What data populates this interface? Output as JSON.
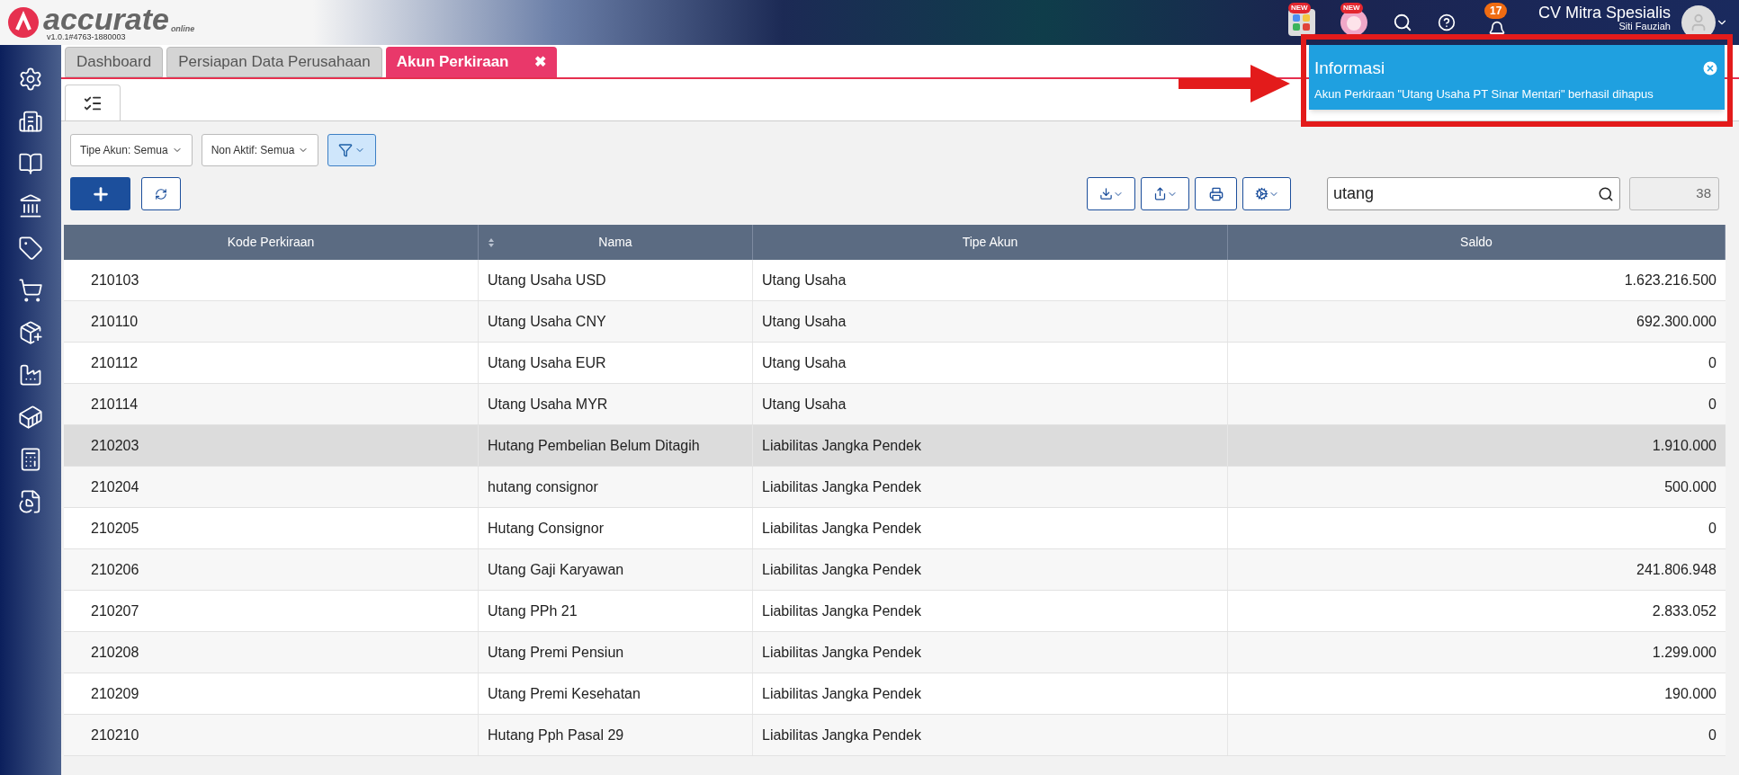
{
  "header": {
    "logo": "accurate",
    "logo_sub": "online",
    "version": "v1.0.1#4763-1880003",
    "new_badges": [
      "NEW",
      "NEW"
    ],
    "notification_count": "17",
    "company": "CV Mitra Spesialis",
    "user": "Siti Fauziah"
  },
  "tabs": [
    {
      "label": "Dashboard",
      "selected": false,
      "closable": false
    },
    {
      "label": "Persiapan Data Perusahaan",
      "selected": false,
      "closable": false
    },
    {
      "label": "Akun Perkiraan",
      "selected": true,
      "closable": true,
      "close": "✖"
    }
  ],
  "filters": [
    {
      "label": "Tipe Akun: Semua"
    },
    {
      "label": "Non Aktif: Semua"
    }
  ],
  "search": {
    "value": "utang",
    "count": "38"
  },
  "table": {
    "columns": [
      "Kode Perkiraan",
      "Nama",
      "Tipe Akun",
      "Saldo"
    ],
    "rows": [
      {
        "code": "210103",
        "name": "Utang Usaha USD",
        "type": "Utang Usaha",
        "balance": "1.623.216.500",
        "highlighted": false
      },
      {
        "code": "210110",
        "name": "Utang Usaha CNY",
        "type": "Utang Usaha",
        "balance": "692.300.000",
        "highlighted": false
      },
      {
        "code": "210112",
        "name": "Utang Usaha EUR",
        "type": "Utang Usaha",
        "balance": "0",
        "highlighted": false
      },
      {
        "code": "210114",
        "name": "Utang Usaha MYR",
        "type": "Utang Usaha",
        "balance": "0",
        "highlighted": false
      },
      {
        "code": "210203",
        "name": "Hutang Pembelian Belum Ditagih",
        "type": "Liabilitas Jangka Pendek",
        "balance": "1.910.000",
        "highlighted": true
      },
      {
        "code": "210204",
        "name": "hutang consignor",
        "type": "Liabilitas Jangka Pendek",
        "balance": "500.000",
        "highlighted": false
      },
      {
        "code": "210205",
        "name": "Hutang Consignor",
        "type": "Liabilitas Jangka Pendek",
        "balance": "0",
        "highlighted": false
      },
      {
        "code": "210206",
        "name": "Utang Gaji Karyawan",
        "type": "Liabilitas Jangka Pendek",
        "balance": "241.806.948",
        "highlighted": false
      },
      {
        "code": "210207",
        "name": "Utang PPh 21",
        "type": "Liabilitas Jangka Pendek",
        "balance": "2.833.052",
        "highlighted": false
      },
      {
        "code": "210208",
        "name": "Utang Premi Pensiun",
        "type": "Liabilitas Jangka Pendek",
        "balance": "1.299.000",
        "highlighted": false
      },
      {
        "code": "210209",
        "name": "Utang Premi Kesehatan",
        "type": "Liabilitas Jangka Pendek",
        "balance": "190.000",
        "highlighted": false
      },
      {
        "code": "210210",
        "name": "Hutang Pph Pasal 29",
        "type": "Liabilitas Jangka Pendek",
        "balance": "0",
        "highlighted": false
      }
    ]
  },
  "notification": {
    "title": "Informasi",
    "message": "Akun Perkiraan \"Utang Usaha PT Sinar Mentari\" berhasil dihapus"
  }
}
